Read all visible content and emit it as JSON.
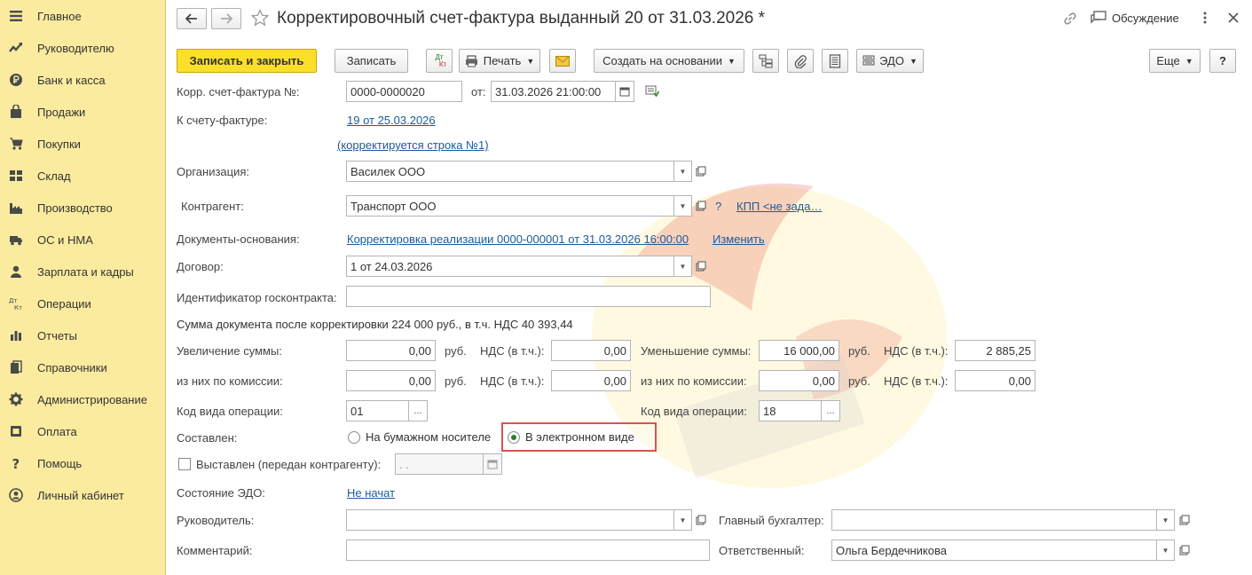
{
  "sidebar": {
    "items": [
      {
        "label": "Главное",
        "icon": "menu-icon"
      },
      {
        "label": "Руководителю",
        "icon": "chart-trend-icon"
      },
      {
        "label": "Банк и касса",
        "icon": "ruble-coin-icon"
      },
      {
        "label": "Продажи",
        "icon": "shopping-bag-icon"
      },
      {
        "label": "Покупки",
        "icon": "cart-icon"
      },
      {
        "label": "Склад",
        "icon": "warehouse-icon"
      },
      {
        "label": "Производство",
        "icon": "factory-icon"
      },
      {
        "label": "ОС и НМА",
        "icon": "truck-icon"
      },
      {
        "label": "Зарплата и кадры",
        "icon": "person-icon"
      },
      {
        "label": "Операции",
        "icon": "debit-credit-icon"
      },
      {
        "label": "Отчеты",
        "icon": "bar-chart-icon"
      },
      {
        "label": "Справочники",
        "icon": "books-icon"
      },
      {
        "label": "Администрирование",
        "icon": "gear-icon"
      },
      {
        "label": "Оплата",
        "icon": "payment-icon"
      },
      {
        "label": "Помощь",
        "icon": "question-icon"
      },
      {
        "label": "Личный кабинет",
        "icon": "account-icon"
      }
    ]
  },
  "header": {
    "title": "Корректировочный счет-фактура выданный 20 от 31.03.2026 *",
    "discussion": "Обсуждение"
  },
  "toolbar": {
    "save_close": "Записать и закрыть",
    "save": "Записать",
    "dtkt_top": "Дт",
    "dtkt_bottom": "Кт",
    "print": "Печать",
    "create_based": "Создать на основании",
    "edo": "ЭДО",
    "more": "Еще",
    "help": "?"
  },
  "form": {
    "corr_invoice_label": "Корр. счет-фактура №:",
    "corr_invoice_number": "0000-0000020",
    "from_label": "от:",
    "from_date": "31.03.2026 21:00:00",
    "to_invoice_label": "К счету-фактуре:",
    "to_invoice_link": "19 от 25.03.2026",
    "corrected_line_link": "(корректируется строка №1)",
    "organization_label": "Организация:",
    "organization_value": "Василек ООО",
    "counterparty_label": "Контрагент:",
    "counterparty_value": "Транспорт ООО",
    "question_mark": "?",
    "kpp_link": "КПП <не зада…",
    "base_docs_label": "Документы-основания:",
    "base_docs_link": "Корректировка реализации 0000-000001 от 31.03.2026 16:00:00",
    "change_link": "Изменить",
    "contract_label": "Договор:",
    "contract_value": "1 от 24.03.2026",
    "gov_contract_label": "Идентификатор госконтракта:",
    "gov_contract_value": "",
    "sum_text": "Сумма документа после корректировки 224 000 руб., в т.ч. НДС 40 393,44",
    "increase_label": "Увеличение суммы:",
    "increase_value": "0,00",
    "rub": "руб.",
    "vat_label": "НДС (в т.ч.):",
    "increase_vat": "0,00",
    "decrease_label": "Уменьшение суммы:",
    "decrease_value": "16 000,00",
    "decrease_vat": "2 885,25",
    "commission_label": "из них по комиссии:",
    "commission_inc_value": "0,00",
    "commission_inc_vat": "0,00",
    "commission_dec_value": "0,00",
    "commission_dec_vat": "0,00",
    "op_code_label": "Код вида операции:",
    "op_code_left": "01",
    "op_code_right": "18",
    "dots": "...",
    "composed_label": "Составлен:",
    "paper_option": "На бумажном носителе",
    "electronic_option": "В электронном виде",
    "issued_label": "Выставлен (передан контрагенту):",
    "issued_date": " .  .",
    "edo_state_label": "Состояние ЭДО:",
    "edo_state_link": "Не начат",
    "manager_label": "Руководитель:",
    "manager_value": "",
    "chief_accountant_label": "Главный бухгалтер:",
    "chief_accountant_value": "",
    "comment_label": "Комментарий:",
    "comment_value": "",
    "responsible_label": "Ответственный:",
    "responsible_value": "Ольга Бердечникова"
  },
  "colors": {
    "sidebar_bg": "#fbeb9f",
    "primary_button": "#fbdf2b",
    "link": "#1c5a9c",
    "highlight_border": "#d9534f"
  }
}
